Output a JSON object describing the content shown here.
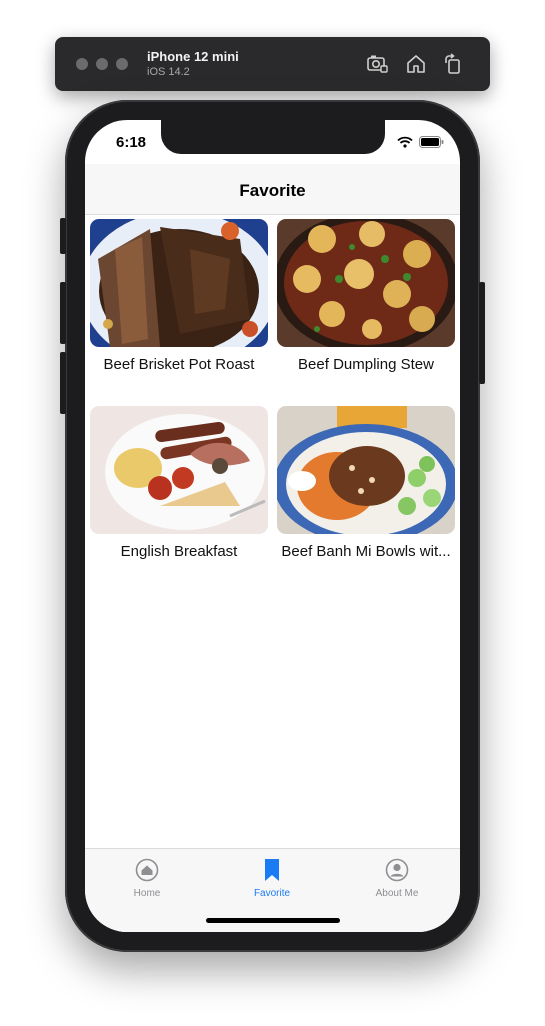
{
  "simulator": {
    "device": "iPhone 12 mini",
    "os": "iOS 14.2",
    "tools": [
      "screenshot-icon",
      "home-icon",
      "rotate-icon"
    ]
  },
  "status_bar": {
    "time": "6:18"
  },
  "nav": {
    "title": "Favorite"
  },
  "recipes": [
    {
      "name": "Beef Brisket Pot Roast"
    },
    {
      "name": "Beef Dumpling Stew"
    },
    {
      "name": "English Breakfast"
    },
    {
      "name": "Beef Banh Mi Bowls wit..."
    }
  ],
  "tabs": [
    {
      "label": "Home",
      "icon": "home-icon",
      "active": false
    },
    {
      "label": "Favorite",
      "icon": "bookmark-icon",
      "active": true
    },
    {
      "label": "About Me",
      "icon": "person-icon",
      "active": false
    }
  ],
  "colors": {
    "accent": "#1a7cf5",
    "inactive": "#8e8e93"
  }
}
